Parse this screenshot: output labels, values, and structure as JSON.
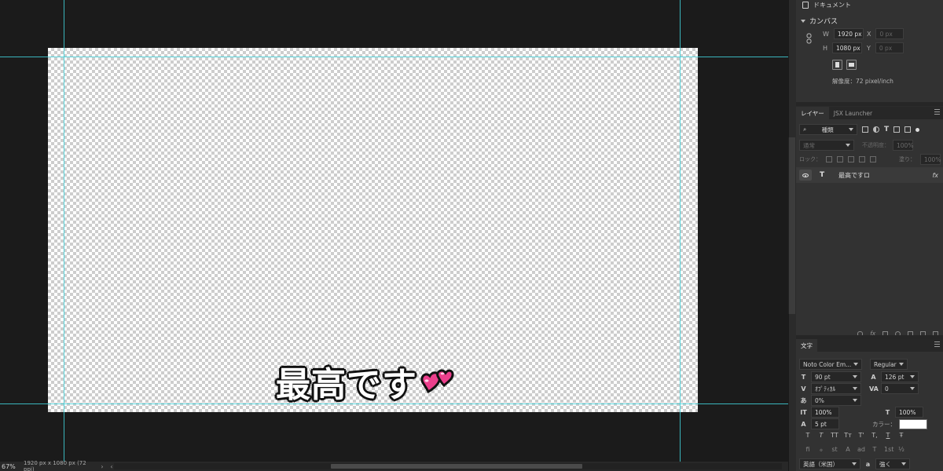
{
  "app": {
    "zoom": "67%",
    "doc_info": "1920 px x 1080 px (72 ppi)",
    "status_arrow_right": "›",
    "status_arrow_left": "‹"
  },
  "canvas": {
    "text": "最高です",
    "emoji_name": "two-hearts-icon",
    "guide_color": "#3fd0d8",
    "emoji_color": "#ec3f8c"
  },
  "properties": {
    "document_label": "ドキュメント",
    "section_title": "カンバス",
    "w_label": "W",
    "w_value": "1920 px",
    "h_label": "H",
    "h_value": "1080 px",
    "x_label": "X",
    "x_value": "0 px",
    "y_label": "Y",
    "y_value": "0 px",
    "resolution": "解像度：72 pixel/inch"
  },
  "layers_panel": {
    "tabs": [
      "レイヤー",
      "JSX Launcher"
    ],
    "filter_kind": "種類",
    "blend_mode": "通常",
    "opacity_label": "不透明度：",
    "opacity_value": "100%",
    "lock_label": "ロック：",
    "fill_label": "塗り：",
    "fill_value": "100%",
    "layers": [
      {
        "type": "T",
        "name": "最高ですロ",
        "fx": "fx"
      }
    ]
  },
  "character_panel": {
    "tab": "文字",
    "font_family": "Noto Color Em...",
    "font_style": "Regular",
    "font_size": "90 pt",
    "leading": "126 pt",
    "kerning": "ｵﾌﾟﾃｨｶﾙ",
    "tracking": "0",
    "tsume": "0%",
    "vertical_scale": "100%",
    "horizontal_scale": "100%",
    "baseline_shift": "5 pt",
    "color_label": "カラー：",
    "color_value": "#ffffff",
    "type_buttons": [
      "T",
      "T",
      "TT",
      "Tт",
      "T'",
      "T,",
      "T",
      "Ŧ"
    ],
    "opentype_buttons": [
      "fi",
      "ℴ",
      "st",
      "A",
      "ad",
      "T",
      "1st",
      "½"
    ],
    "language": "英語（米国）",
    "antialias": "強く"
  }
}
